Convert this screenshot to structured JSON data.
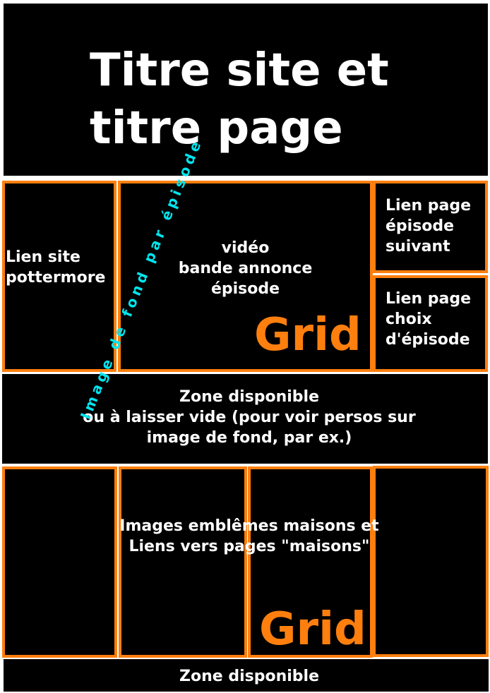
{
  "header": {
    "title_line1": "Titre site et",
    "title_line2": "titre page"
  },
  "row1": {
    "pottermore_link": [
      "Lien site",
      "pottermore"
    ],
    "video": [
      "vidéo",
      "bande annonce",
      "épisode"
    ],
    "next_episode_link": [
      "Lien page",
      "épisode",
      "suivant"
    ],
    "choose_episode_link": [
      "Lien page",
      "choix",
      "d'épisode"
    ],
    "grid_label": "Grid"
  },
  "background_note": "Image de fond par épisode",
  "free_zone_1": [
    "Zone disponible",
    "ou à laisser vide (pour voir persos sur",
    "image de fond, par ex.)"
  ],
  "houses": {
    "text": [
      "Images emblêmes maisons et",
      "Liens vers pages \"maisons\""
    ],
    "grid_label": "Grid"
  },
  "free_zone_2": "Zone disponible",
  "colors": {
    "grid_border": "#ff7f0e",
    "background_text": "#00e5ee",
    "panel": "#000000",
    "text": "#ffffff"
  }
}
